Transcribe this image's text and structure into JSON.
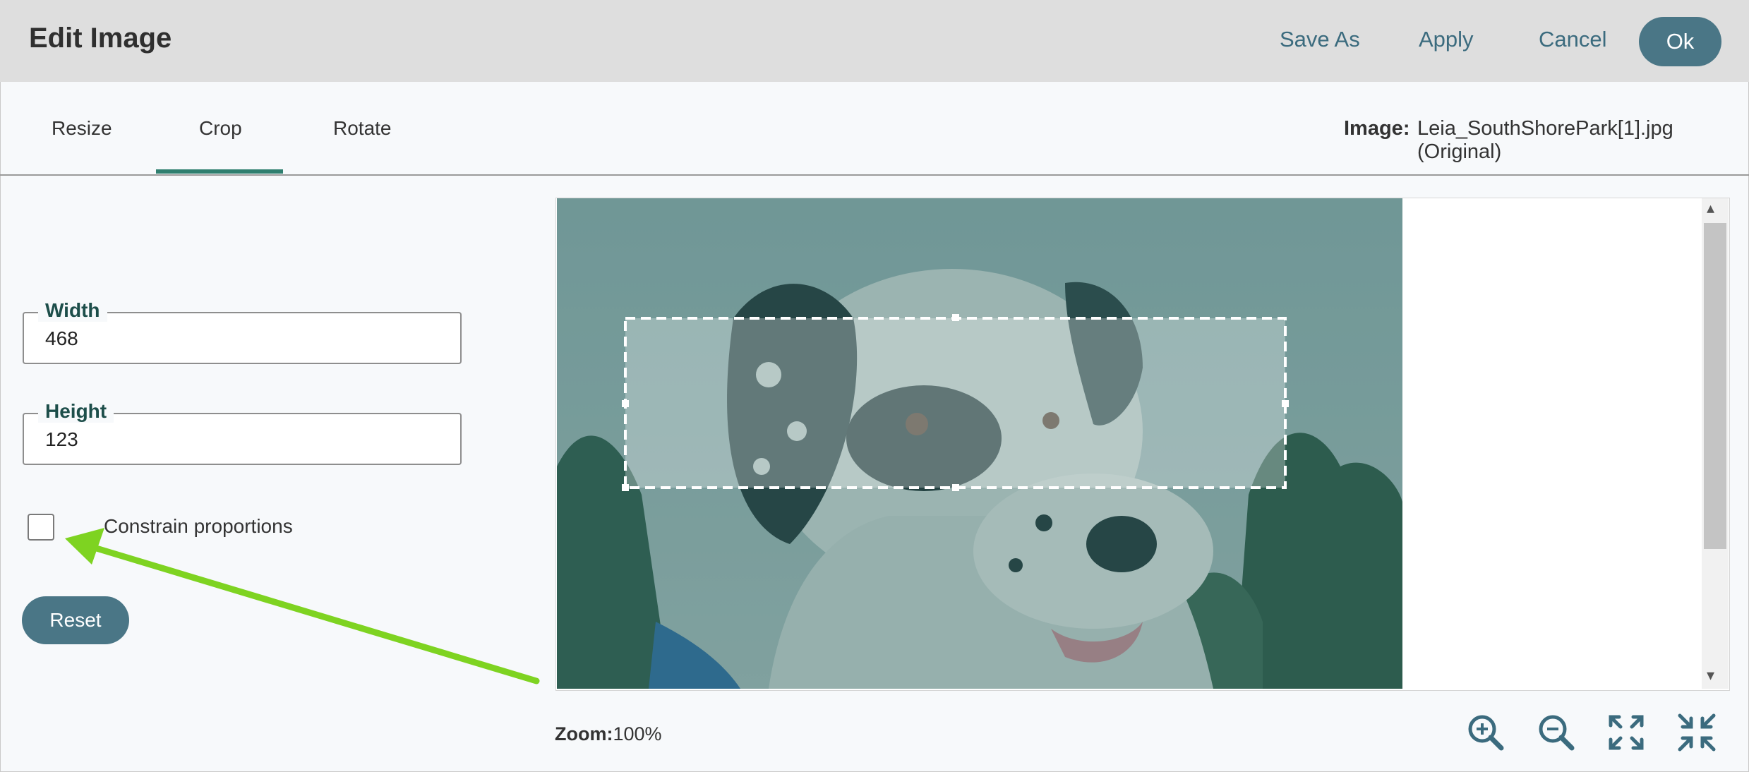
{
  "header": {
    "title": "Edit Image",
    "save_as": "Save As",
    "apply": "Apply",
    "cancel": "Cancel",
    "ok": "Ok"
  },
  "tabs": [
    {
      "label": "Resize"
    },
    {
      "label": "Crop",
      "active": true
    },
    {
      "label": "Rotate"
    }
  ],
  "image_info": {
    "label": "Image:",
    "name": "Leia_SouthShorePark[1].jpg (Original)"
  },
  "crop": {
    "width_label": "Width",
    "width_value": "468",
    "height_label": "Height",
    "height_value": "123",
    "constrain_label": "Constrain proportions",
    "constrain_checked": false,
    "reset_label": "Reset"
  },
  "zoom": {
    "label": "Zoom:",
    "value": "100%"
  },
  "icons": [
    "zoom-in-icon",
    "zoom-out-icon",
    "expand-icon",
    "compress-icon"
  ],
  "colors": {
    "accent": "#4a7686",
    "tab_underline": "#2f7f6f",
    "annotation_arrow": "#7ed321"
  }
}
